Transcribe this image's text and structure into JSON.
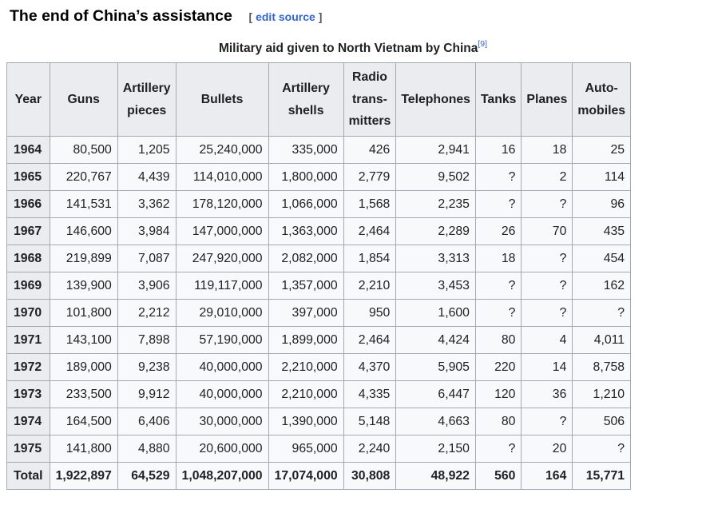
{
  "section": {
    "title": "The end of China’s assistance",
    "edit_open": "[",
    "edit_label": "edit source",
    "edit_close": "]"
  },
  "table": {
    "caption": "Military aid given to North Vietnam by China",
    "footnote": "[9]",
    "headers": {
      "year": "Year",
      "guns": "Guns",
      "artillery_pieces": [
        "Artillery",
        "pieces"
      ],
      "bullets": "Bullets",
      "artillery_shells": [
        "Artillery",
        "shells"
      ],
      "radio_transmitters": [
        "Radio",
        "trans-",
        "mitters"
      ],
      "telephones": "Telephones",
      "tanks": "Tanks",
      "planes": "Planes",
      "automobiles": [
        "Auto-",
        "mobiles"
      ]
    },
    "rows": [
      [
        "1964",
        "80,500",
        "1,205",
        "25,240,000",
        "335,000",
        "426",
        "2,941",
        "16",
        "18",
        "25"
      ],
      [
        "1965",
        "220,767",
        "4,439",
        "114,010,000",
        "1,800,000",
        "2,779",
        "9,502",
        "?",
        "2",
        "114"
      ],
      [
        "1966",
        "141,531",
        "3,362",
        "178,120,000",
        "1,066,000",
        "1,568",
        "2,235",
        "?",
        "?",
        "96"
      ],
      [
        "1967",
        "146,600",
        "3,984",
        "147,000,000",
        "1,363,000",
        "2,464",
        "2,289",
        "26",
        "70",
        "435"
      ],
      [
        "1968",
        "219,899",
        "7,087",
        "247,920,000",
        "2,082,000",
        "1,854",
        "3,313",
        "18",
        "?",
        "454"
      ],
      [
        "1969",
        "139,900",
        "3,906",
        "119,117,000",
        "1,357,000",
        "2,210",
        "3,453",
        "?",
        "?",
        "162"
      ],
      [
        "1970",
        "101,800",
        "2,212",
        "29,010,000",
        "397,000",
        "950",
        "1,600",
        "?",
        "?",
        "?"
      ],
      [
        "1971",
        "143,100",
        "7,898",
        "57,190,000",
        "1,899,000",
        "2,464",
        "4,424",
        "80",
        "4",
        "4,011"
      ],
      [
        "1972",
        "189,000",
        "9,238",
        "40,000,000",
        "2,210,000",
        "4,370",
        "5,905",
        "220",
        "14",
        "8,758"
      ],
      [
        "1973",
        "233,500",
        "9,912",
        "40,000,000",
        "2,210,000",
        "4,335",
        "6,447",
        "120",
        "36",
        "1,210"
      ],
      [
        "1974",
        "164,500",
        "6,406",
        "30,000,000",
        "1,390,000",
        "5,148",
        "4,663",
        "80",
        "?",
        "506"
      ],
      [
        "1975",
        "141,800",
        "4,880",
        "20,600,000",
        "965,000",
        "2,240",
        "2,150",
        "?",
        "20",
        "?"
      ]
    ],
    "total": [
      "Total",
      "1,922,897",
      "64,529",
      "1,048,207,000",
      "17,074,000",
      "30,808",
      "48,922",
      "560",
      "164",
      "15,771"
    ]
  }
}
